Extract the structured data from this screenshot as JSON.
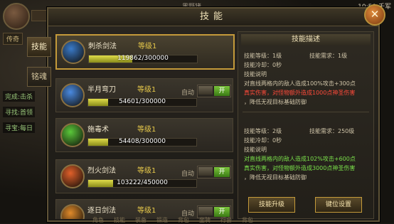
{
  "hud": {
    "tag": "传奇",
    "lines": [
      "完成:击杀",
      "寻找:首领",
      "寻宝:每日"
    ],
    "time": "10:50",
    "server": "千军",
    "map": "黑野猪"
  },
  "window": {
    "title": "技能",
    "close_label": "✕",
    "side_tabs": [
      "技能",
      "铭魂"
    ]
  },
  "skills": [
    {
      "name": "刺杀剑法",
      "level": "等级1",
      "progress": "119862/300000",
      "fraction": 0.3996,
      "auto": "",
      "toggle": "",
      "icon_color": "#3a7ac8"
    },
    {
      "name": "半月弯刀",
      "level": "等级1",
      "progress": "54601/300000",
      "fraction": 0.182,
      "auto": "自动",
      "toggle": "开",
      "icon_color": "#4a8ae0"
    },
    {
      "name": "施毒术",
      "level": "等级1",
      "progress": "54408/300000",
      "fraction": 0.181,
      "auto": "",
      "toggle": "",
      "icon_color": "#5ac83a"
    },
    {
      "name": "烈火剑法",
      "level": "等级1",
      "progress": "103222/450000",
      "fraction": 0.229,
      "auto": "自动",
      "toggle": "开",
      "icon_color": "#e0602a"
    },
    {
      "name": "逐日剑法",
      "level": "等级1",
      "progress": "",
      "fraction": 0,
      "auto": "自动",
      "toggle": "开",
      "icon_color": "#e08a2a"
    }
  ],
  "desc": {
    "title": "技能描述",
    "cur_level": "技能等级：1级",
    "cur_need": "技能需求：1级",
    "cur_cd": "技能冷却：0秒",
    "cur_label": "技能说明",
    "cur_line1": "对直线两格内的敌人造成100%攻击+300点",
    "cur_line2": "真实伤害，对怪物额外造成1000点神圣伤害",
    "cur_line3": "，降低无视目标基础防御",
    "next_level": "技能等级：2级",
    "next_need": "技能需求：250级",
    "next_cd": "技能冷却：0秒",
    "next_label": "技能说明",
    "next_line1": "对直线两格内的敌人造成102%攻击+600点",
    "next_line2": "真实伤害，对怪物额外造成3000点神圣伤害",
    "next_line3": "，降低无视目标基础防御",
    "upgrade_btn": "技能升级",
    "keybind_btn": "键位设置"
  },
  "bottom_menu": [
    "角色",
    "技能",
    "装备",
    "锻造",
    "背包",
    "坐骑",
    "行会",
    "背包"
  ]
}
